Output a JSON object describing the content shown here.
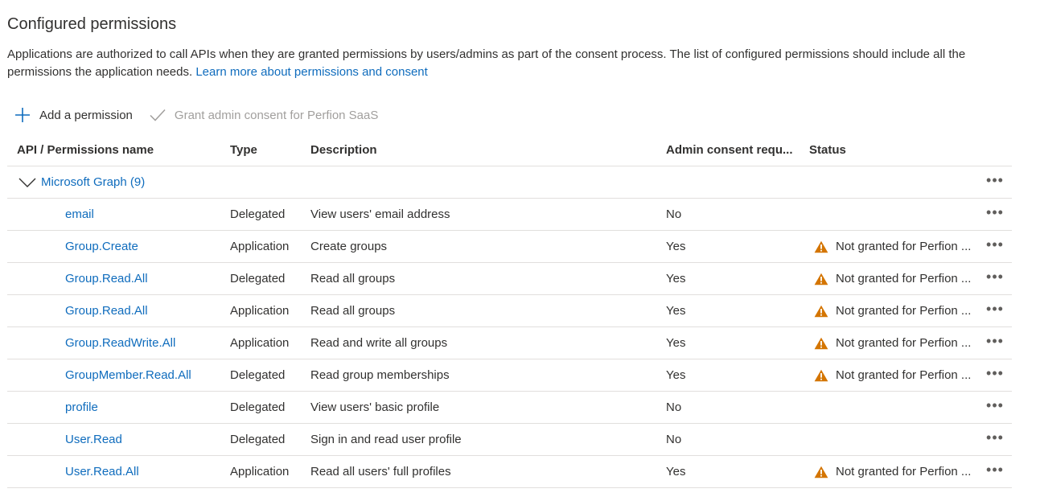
{
  "title": "Configured permissions",
  "description": {
    "text": "Applications are authorized to call APIs when they are granted permissions by users/admins as part of the consent process. The list of configured permissions should include all the permissions the application needs.",
    "link": "Learn more about permissions and consent"
  },
  "toolbar": {
    "add_label": "Add a permission",
    "grant_label": "Grant admin consent for Perfion SaaS"
  },
  "table": {
    "headers": {
      "api": "API / Permissions name",
      "type": "Type",
      "description": "Description",
      "admin": "Admin consent requ...",
      "status": "Status"
    },
    "group": {
      "name": "Microsoft Graph (9)"
    },
    "more_label": "•••",
    "rows": [
      {
        "name": "email",
        "type": "Delegated",
        "description": "View users' email address",
        "admin": "No",
        "status": ""
      },
      {
        "name": "Group.Create",
        "type": "Application",
        "description": "Create groups",
        "admin": "Yes",
        "status": "Not granted for Perfion ..."
      },
      {
        "name": "Group.Read.All",
        "type": "Delegated",
        "description": "Read all groups",
        "admin": "Yes",
        "status": "Not granted for Perfion ..."
      },
      {
        "name": "Group.Read.All",
        "type": "Application",
        "description": "Read all groups",
        "admin": "Yes",
        "status": "Not granted for Perfion ..."
      },
      {
        "name": "Group.ReadWrite.All",
        "type": "Application",
        "description": "Read and write all groups",
        "admin": "Yes",
        "status": "Not granted for Perfion ..."
      },
      {
        "name": "GroupMember.Read.All",
        "type": "Delegated",
        "description": "Read group memberships",
        "admin": "Yes",
        "status": "Not granted for Perfion ..."
      },
      {
        "name": "profile",
        "type": "Delegated",
        "description": "View users' basic profile",
        "admin": "No",
        "status": ""
      },
      {
        "name": "User.Read",
        "type": "Delegated",
        "description": "Sign in and read user profile",
        "admin": "No",
        "status": ""
      },
      {
        "name": "User.Read.All",
        "type": "Application",
        "description": "Read all users' full profiles",
        "admin": "Yes",
        "status": "Not granted for Perfion ..."
      }
    ]
  },
  "colors": {
    "link": "#0f6cbd",
    "warning": "#d47500",
    "disabled": "#a19f9d"
  },
  "icons": {
    "add": "plus-icon",
    "grant": "checkmark-icon",
    "expand": "chevron-down-icon",
    "warning": "warning-icon",
    "more": "more-icon"
  }
}
